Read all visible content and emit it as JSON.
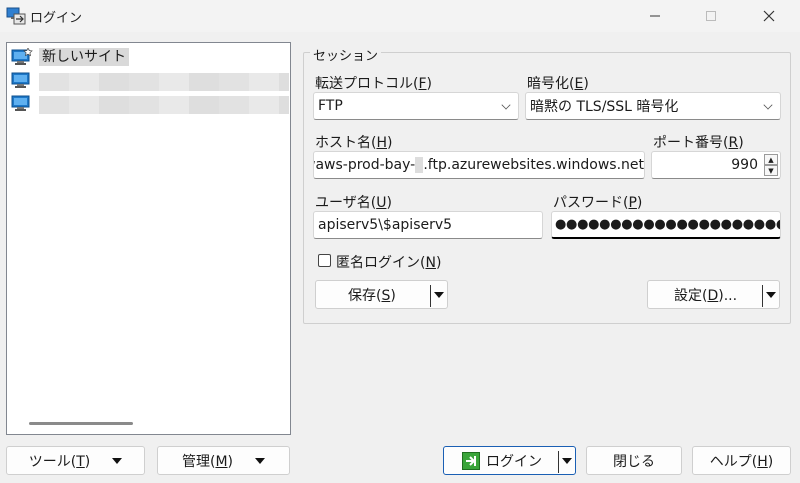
{
  "window": {
    "title": "ログイン"
  },
  "tree": {
    "items": [
      {
        "label": "新しいサイト",
        "selected": true
      },
      {
        "label": "",
        "selected": false
      },
      {
        "label": "",
        "selected": false
      }
    ]
  },
  "left_buttons": {
    "tools": "ツール(",
    "tools_key": "T",
    "manage": "管理(",
    "manage_key": "M"
  },
  "session": {
    "legend": "セッション",
    "protocol_label": "転送プロトコル(",
    "protocol_key": "F",
    "protocol_value": "FTP",
    "encryption_label": "暗号化(",
    "encryption_key": "E",
    "encryption_value": "暗黙の TLS/SSL 暗号化",
    "host_label": "ホスト名(",
    "host_key": "H",
    "host_value_prefix": "waws-prod-bay-",
    "host_value_suffix": ".ftp.azurewebsites.windows.net",
    "port_label": "ポート番号(",
    "port_key": "R",
    "port_value": "990",
    "user_label": "ユーザ名(",
    "user_key": "U",
    "user_value": "apiserv5\\$apiserv5",
    "password_label": "パスワード(",
    "password_key": "P",
    "password_value": "●●●●●●●●●●●●●●●●●●●●●●●●●●",
    "anonymous_label": "匿名ログイン(",
    "anonymous_key": "N",
    "anonymous_checked": false,
    "save_label": "保存(",
    "save_key": "S",
    "advanced_label": "設定(",
    "advanced_key": "D",
    "advanced_suffix": ")..."
  },
  "bottom_buttons": {
    "login": "ログイン",
    "close": "閉じる",
    "help": "ヘルプ(",
    "help_key": "H"
  },
  "colors": {
    "accent_green": "#3aa53a",
    "monitor_blue": "#1e78c8"
  }
}
